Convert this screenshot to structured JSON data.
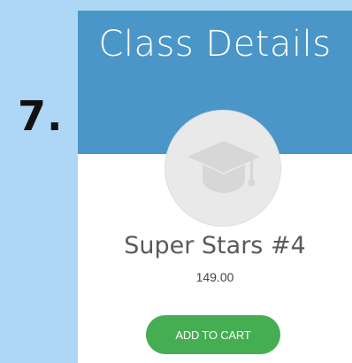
{
  "step": {
    "number": "7."
  },
  "card": {
    "title": "Class Details",
    "image_icon": "graduation-cap-icon",
    "class_name": "Super Stars #4",
    "price": "149.00",
    "add_to_cart_label": "ADD TO CART"
  },
  "colors": {
    "page_background": "#aed6f5",
    "header_background": "#4b96c8",
    "button_background": "#45ae52",
    "card_background": "#ffffff",
    "placeholder_circle": "#e9e9e9",
    "icon_gray": "#d7d7d7"
  }
}
